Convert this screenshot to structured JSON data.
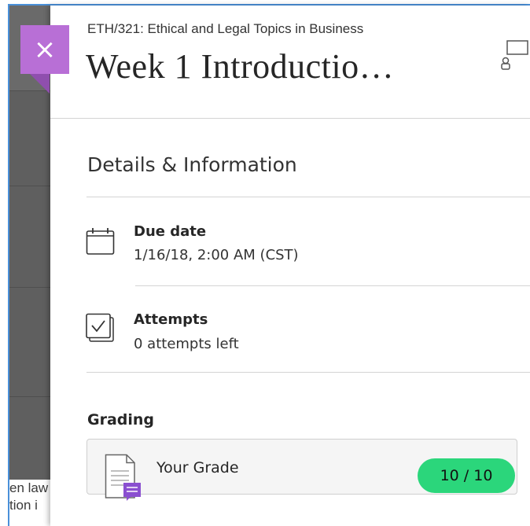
{
  "panel": {
    "course_name": "ETH/321: Ethical and Legal Topics in Business",
    "title": "Week 1 Introductio…",
    "close_label": "×"
  },
  "details": {
    "section_title": "Details & Information",
    "due_date": {
      "label": "Due date",
      "value": "1/16/18, 2:00 AM (CST)",
      "icon": "calendar-icon"
    },
    "attempts": {
      "label": "Attempts",
      "value": "0 attempts left",
      "icon": "attempts-icon"
    }
  },
  "grading": {
    "section_title": "Grading",
    "your_grade_label": "Your Grade",
    "grade_value": "10 / 10",
    "grade_color": "#2bd67b"
  },
  "background_page": {
    "text_lines": [
      "en law",
      "tion i"
    ]
  },
  "colors": {
    "accent": "#b86fd6",
    "accent_dark": "#8f4fae",
    "border_blue": "#4a90d9"
  }
}
